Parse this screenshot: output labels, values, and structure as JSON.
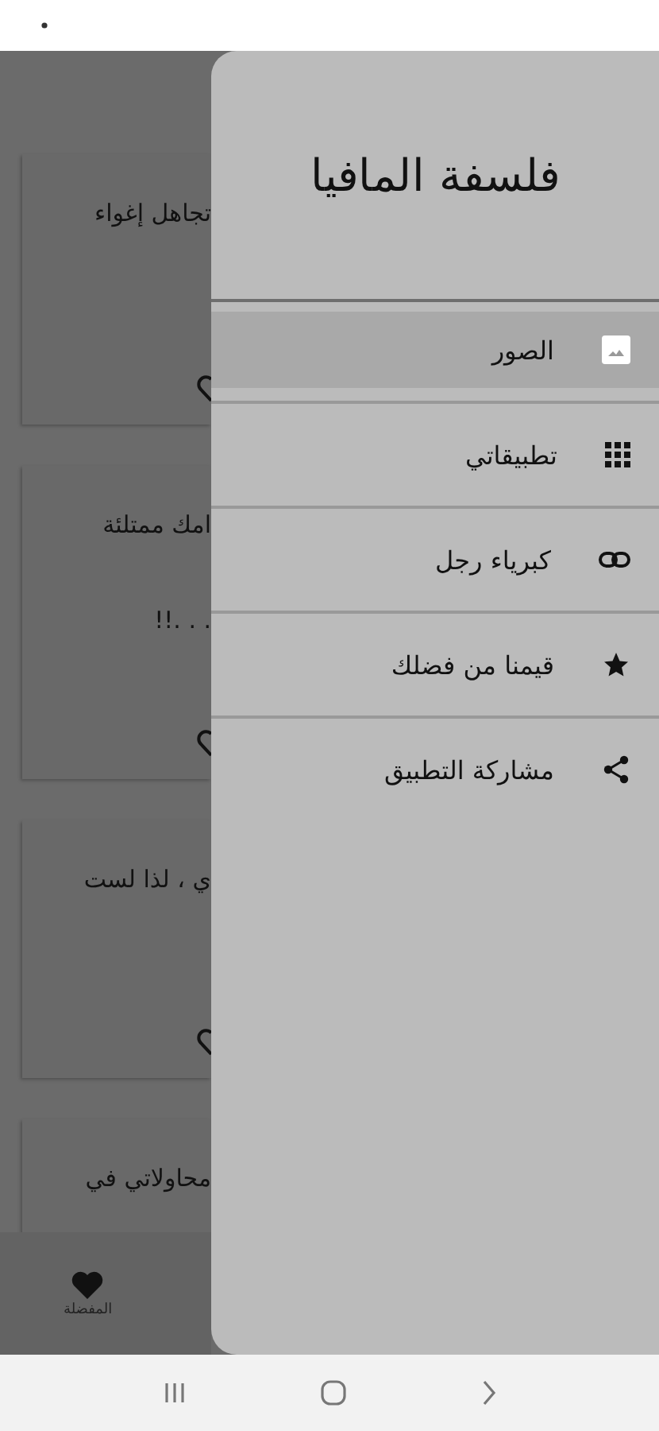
{
  "background_cards": [
    {
      "lines": [
        "تجاهل إغواء"
      ]
    },
    {
      "lines": [
        "امك ممتلئة",
        ". . .!!"
      ]
    },
    {
      "lines": [
        "ي ، لذا لست"
      ]
    },
    {
      "lines": [
        "محاولاتي في"
      ]
    }
  ],
  "bottom_nav": {
    "items": [
      {
        "label": "المفضلة"
      }
    ]
  },
  "drawer": {
    "title": "فلسفة المافيا",
    "items": [
      {
        "label": "الصور",
        "selected": true
      },
      {
        "label": "تطبيقاتي",
        "selected": false
      },
      {
        "label": "كبرياء رجل",
        "selected": false
      },
      {
        "label": "قيمنا من فضلك",
        "selected": false
      },
      {
        "label": "مشاركة التطبيق",
        "selected": false
      }
    ]
  }
}
